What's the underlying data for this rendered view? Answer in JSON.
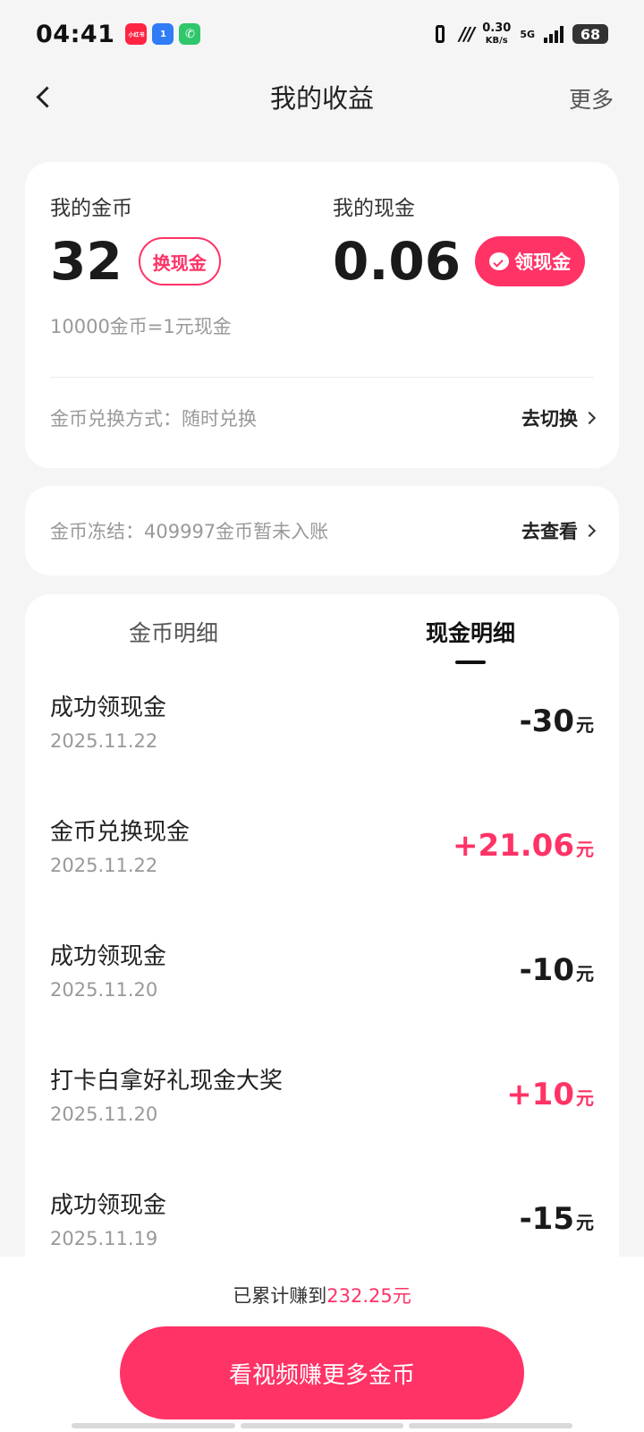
{
  "status": {
    "time": "04:41",
    "apps": [
      "小红书",
      "1",
      "✆"
    ],
    "net_speed_value": "0.30",
    "net_speed_unit": "KB/s",
    "network": "5G",
    "battery": "68"
  },
  "nav": {
    "title": "我的收益",
    "more": "更多"
  },
  "balance": {
    "coins_label": "我的金币",
    "coins_value": "32",
    "exchange_button": "换现金",
    "cash_label": "我的现金",
    "cash_value": "0.06",
    "withdraw_button": "领现金",
    "rate": "10000金币=1元现金",
    "exchange_mode": "金币兑换方式：随时兑换",
    "switch_link": "去切换"
  },
  "frozen": {
    "text": "金币冻结：409997金币暂未入账",
    "link": "去查看"
  },
  "tabs": [
    {
      "label": "金币明细",
      "active": false
    },
    {
      "label": "现金明细",
      "active": true
    }
  ],
  "records": [
    {
      "title": "成功领现金",
      "date": "2025.11.22",
      "amount": "-30",
      "unit": "元",
      "type": "minus"
    },
    {
      "title": "金币兑换现金",
      "date": "2025.11.22",
      "amount": "+21.06",
      "unit": "元",
      "type": "plus"
    },
    {
      "title": "成功领现金",
      "date": "2025.11.20",
      "amount": "-10",
      "unit": "元",
      "type": "minus"
    },
    {
      "title": "打卡白拿好礼现金大奖",
      "date": "2025.11.20",
      "amount": "+10",
      "unit": "元",
      "type": "plus"
    },
    {
      "title": "成功领现金",
      "date": "2025.11.19",
      "amount": "-15",
      "unit": "元",
      "type": "minus"
    }
  ],
  "bottom": {
    "earned_prefix": "已累计赚到",
    "earned_value": "232.25元",
    "cta": "看视频赚更多金币"
  },
  "colors": {
    "accent": "#ff3366",
    "background": "#f5f5f5"
  }
}
